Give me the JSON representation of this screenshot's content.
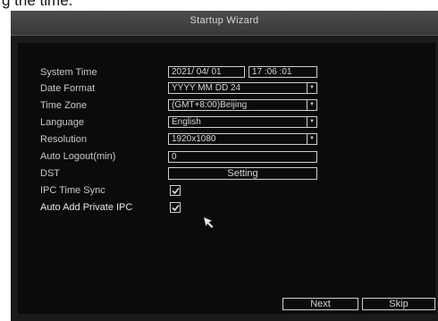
{
  "caption": {
    "text": "g the time."
  },
  "window": {
    "title": "Startup Wizard"
  },
  "form": {
    "system_time": {
      "label": "System Time",
      "date": "2021/ 04/ 01",
      "time": "17 :06 :01"
    },
    "date_format": {
      "label": "Date Format",
      "value": "YYYY MM DD 24"
    },
    "time_zone": {
      "label": "Time Zone",
      "value": "(GMT+8:00)Beijing"
    },
    "language": {
      "label": "Language",
      "value": "English"
    },
    "resolution": {
      "label": "Resolution",
      "value": "1920x1080"
    },
    "auto_logout": {
      "label": "Auto Logout(min)",
      "value": "0"
    },
    "dst": {
      "label": "DST",
      "button": "Setting"
    },
    "ipc_time_sync": {
      "label": "IPC Time Sync",
      "checked": true
    },
    "auto_add_ipc": {
      "label": "Auto Add Private IPC",
      "checked": true
    }
  },
  "footer": {
    "next_label": "Next",
    "skip_label": "Skip"
  },
  "icons": {
    "dropdown": "chevron-down-icon",
    "check": "checkmark-icon",
    "cursor": "mouse-pointer-icon"
  },
  "colors": {
    "background": "#0b0b0b",
    "titlebar": "#444444",
    "text": "#cccccc",
    "border": "#cfcfcf"
  }
}
